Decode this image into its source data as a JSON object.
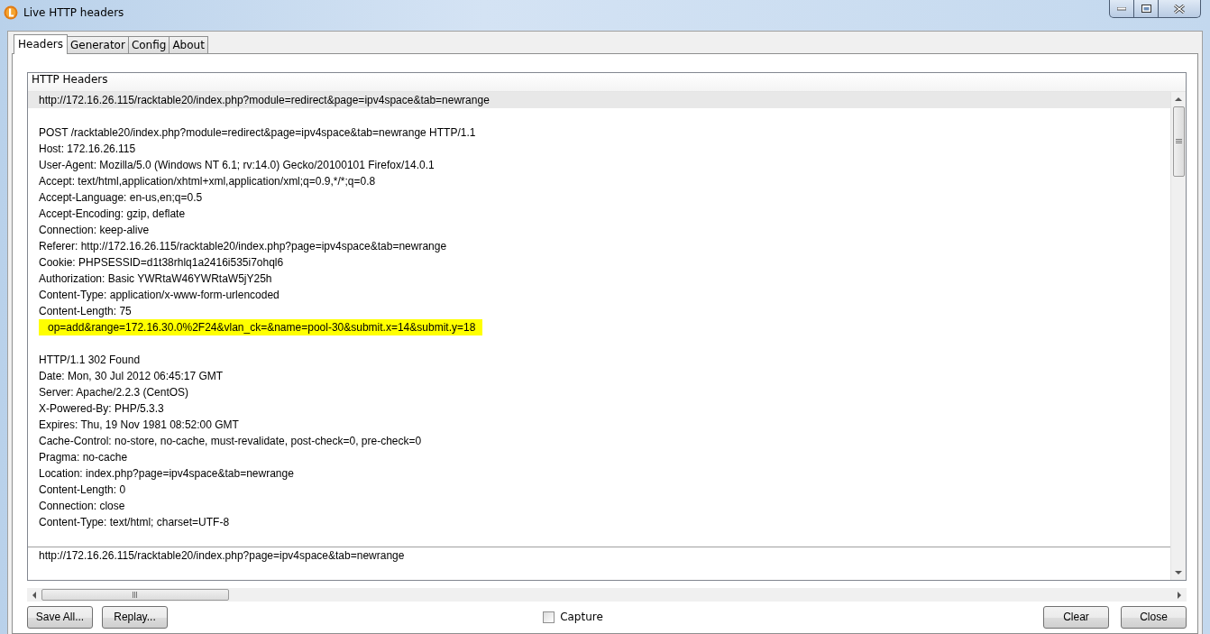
{
  "window": {
    "title": "Live HTTP headers"
  },
  "tabs": [
    {
      "label": "Headers",
      "selected": true
    },
    {
      "label": "Generator",
      "selected": false
    },
    {
      "label": "Config",
      "selected": false
    },
    {
      "label": "About",
      "selected": false
    }
  ],
  "panel": {
    "heading": "HTTP Headers"
  },
  "entries": [
    {
      "url": "http://172.16.26.115/racktable20/index.php?module=redirect&page=ipv4space&tab=newrange",
      "selected": true,
      "blocks": [
        {
          "lines": [
            {
              "kind": "header",
              "text": "POST /racktable20/index.php?module=redirect&page=ipv4space&tab=newrange HTTP/1.1"
            },
            {
              "kind": "header",
              "text": "Host: 172.16.26.115"
            },
            {
              "kind": "header",
              "text": "User-Agent: Mozilla/5.0 (Windows NT 6.1; rv:14.0) Gecko/20100101 Firefox/14.0.1"
            },
            {
              "kind": "header",
              "text": "Accept: text/html,application/xhtml+xml,application/xml;q=0.9,*/*;q=0.8"
            },
            {
              "kind": "header",
              "text": "Accept-Language: en-us,en;q=0.5"
            },
            {
              "kind": "header",
              "text": "Accept-Encoding: gzip, deflate"
            },
            {
              "kind": "header",
              "text": "Connection: keep-alive"
            },
            {
              "kind": "header",
              "text": "Referer: http://172.16.26.115/racktable20/index.php?page=ipv4space&tab=newrange"
            },
            {
              "kind": "header",
              "text": "Cookie: PHPSESSID=d1t38rhlq1a2416i535i7ohql6"
            },
            {
              "kind": "header",
              "text": "Authorization: Basic YWRtaW46YWRtaW5jY25h"
            },
            {
              "kind": "header",
              "text": "Content-Type: application/x-www-form-urlencoded"
            },
            {
              "kind": "header",
              "text": "Content-Length: 75"
            },
            {
              "kind": "body",
              "text": "op=add&range=172.16.30.0%2F24&vlan_ck=&name=pool-30&submit.x=14&submit.y=18"
            }
          ]
        },
        {
          "lines": [
            {
              "kind": "header",
              "text": "HTTP/1.1 302 Found"
            },
            {
              "kind": "header",
              "text": "Date: Mon, 30 Jul 2012 06:45:17 GMT"
            },
            {
              "kind": "header",
              "text": "Server: Apache/2.2.3 (CentOS)"
            },
            {
              "kind": "header",
              "text": "X-Powered-By: PHP/5.3.3"
            },
            {
              "kind": "header",
              "text": "Expires: Thu, 19 Nov 1981 08:52:00 GMT"
            },
            {
              "kind": "header",
              "text": "Cache-Control: no-store, no-cache, must-revalidate, post-check=0, pre-check=0"
            },
            {
              "kind": "header",
              "text": "Pragma: no-cache"
            },
            {
              "kind": "header",
              "text": "Location: index.php?page=ipv4space&tab=newrange"
            },
            {
              "kind": "header",
              "text": "Content-Length: 0"
            },
            {
              "kind": "header",
              "text": "Connection: close"
            },
            {
              "kind": "header",
              "text": "Content-Type: text/html; charset=UTF-8"
            }
          ]
        }
      ]
    },
    {
      "url": "http://172.16.26.115/racktable20/index.php?page=ipv4space&tab=newrange",
      "selected": false
    }
  ],
  "buttons_left": [
    {
      "label": "Save All..."
    },
    {
      "label": "Replay..."
    }
  ],
  "capture": {
    "label": "Capture",
    "checked": false
  },
  "buttons_right": [
    {
      "label": "Clear"
    },
    {
      "label": "Close"
    }
  ]
}
